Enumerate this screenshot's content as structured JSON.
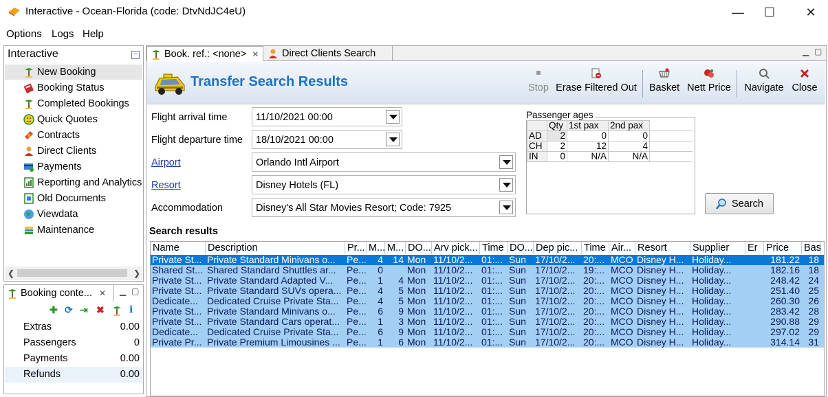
{
  "window": {
    "title": "Interactive - Ocean-Florida (code: DtvNdJC4eU)",
    "minimize": "—",
    "maximize": "☐",
    "close": "✕"
  },
  "menu": [
    "Options",
    "Logs",
    "Help"
  ],
  "sidebar": {
    "title": "Interactive",
    "items": [
      {
        "label": "New Booking",
        "icon": "palm-tree-icon"
      },
      {
        "label": "Booking Status",
        "icon": "book-icon"
      },
      {
        "label": "Completed Bookings",
        "icon": "palm-tree-icon"
      },
      {
        "label": "Quick Quotes",
        "icon": "smiley-icon"
      },
      {
        "label": "Contracts",
        "icon": "satellite-icon"
      },
      {
        "label": "Direct Clients",
        "icon": "person-icon"
      },
      {
        "label": "Payments",
        "icon": "payment-icon"
      },
      {
        "label": "Reporting and Analytics",
        "icon": "report-icon"
      },
      {
        "label": "Old Documents",
        "icon": "document-icon"
      },
      {
        "label": "Viewdata",
        "icon": "globe-icon"
      },
      {
        "label": "Maintenance",
        "icon": "maintenance-icon"
      }
    ]
  },
  "booking_context": {
    "tab_label": "Booking conte...",
    "rows": [
      {
        "label": "Extras",
        "value": "0.00"
      },
      {
        "label": "Passengers",
        "value": "0"
      },
      {
        "label": "Payments",
        "value": "0.00"
      },
      {
        "label": "Refunds",
        "value": "0.00"
      }
    ]
  },
  "tabs": [
    {
      "label": "Book. ref.: <none>"
    },
    {
      "label": "Direct Clients Search"
    }
  ],
  "page": {
    "title": "Transfer Search Results",
    "toolbar": {
      "stop": "Stop",
      "erase": "Erase Filtered Out",
      "basket": "Basket",
      "nett": "Nett Price",
      "navigate": "Navigate",
      "close": "Close"
    }
  },
  "form": {
    "arrival_label": "Flight arrival time",
    "arrival_value": "11/10/2021 00:00",
    "departure_label": "Flight departure time",
    "departure_value": "18/10/2021 00:00",
    "airport_label": "Airport",
    "airport_value": "Orlando Intl Airport",
    "resort_label": "Resort",
    "resort_value": "Disney Hotels (FL)",
    "accommodation_label": "Accommodation",
    "accommodation_value": "Disney's All Star Movies Resort; Code: 7925"
  },
  "passenger_ages": {
    "caption": "Passenger ages",
    "headers": [
      "",
      "Qty",
      "1st pax",
      "2nd pax"
    ],
    "rows": [
      [
        "AD",
        "2",
        "0",
        "0"
      ],
      [
        "CH",
        "2",
        "12",
        "4"
      ],
      [
        "IN",
        "0",
        "N/A",
        "N/A"
      ]
    ]
  },
  "search_button": "Search",
  "results": {
    "label": "Search results",
    "columns": [
      "Name",
      "Description",
      "Pr...",
      "M...",
      "M...",
      "DO...",
      "Arv pick...",
      "Time",
      "DO...",
      "Dep pic...",
      "Time",
      "Air...",
      "Resort",
      "Supplier",
      "Er",
      "Price",
      "Bas"
    ],
    "rows": [
      [
        "Private St...",
        "Private Standard Minivans o...",
        "Pe...",
        "4",
        "14",
        "Mon",
        "11/10/2...",
        "01:...",
        "Sun",
        "17/10/2...",
        "20:...",
        "MCO",
        "Disney H...",
        "Holiday...",
        "",
        "181.22",
        "18"
      ],
      [
        "Shared St...",
        "Shared Standard Shuttles ar...",
        "Pe...",
        "0",
        "",
        "Mon",
        "11/10/2...",
        "01:...",
        "Sun",
        "17/10/2...",
        "19:...",
        "MCO",
        "Disney H...",
        "Holiday...",
        "",
        "182.16",
        "18"
      ],
      [
        "Private St...",
        "Private Standard Adapted V...",
        "Pe...",
        "1",
        "4",
        "Mon",
        "11/10/2...",
        "01:...",
        "Sun",
        "17/10/2...",
        "20:...",
        "MCO",
        "Disney H...",
        "Holiday...",
        "",
        "248.42",
        "24"
      ],
      [
        "Private St...",
        "Private Standard SUVs opera...",
        "Pe...",
        "4",
        "5",
        "Mon",
        "11/10/2...",
        "01:...",
        "Sun",
        "17/10/2...",
        "20:...",
        "MCO",
        "Disney H...",
        "Holiday...",
        "",
        "251.40",
        "25"
      ],
      [
        "Dedicate...",
        "Dedicated Cruise Private Sta...",
        "Pe...",
        "4",
        "5",
        "Mon",
        "11/10/2...",
        "01:...",
        "Sun",
        "17/10/2...",
        "20:...",
        "MCO",
        "Disney H...",
        "Holiday...",
        "",
        "260.30",
        "26"
      ],
      [
        "Private St...",
        "Private Standard Minivans o...",
        "Pe...",
        "6",
        "9",
        "Mon",
        "11/10/2...",
        "01:...",
        "Sun",
        "17/10/2...",
        "20:...",
        "MCO",
        "Disney H...",
        "Holiday...",
        "",
        "283.42",
        "28"
      ],
      [
        "Private St...",
        "Private Standard Cars operat...",
        "Pe...",
        "1",
        "3",
        "Mon",
        "11/10/2...",
        "01:...",
        "Sun",
        "17/10/2...",
        "20:...",
        "MCO",
        "Disney H...",
        "Holiday...",
        "",
        "290.88",
        "29"
      ],
      [
        "Dedicate...",
        "Dedicated Cruise Private Sta...",
        "Pe...",
        "6",
        "9",
        "Mon",
        "11/10/2...",
        "01:...",
        "Sun",
        "17/10/2...",
        "20:...",
        "MCO",
        "Disney H...",
        "Holiday...",
        "",
        "297.02",
        "29"
      ],
      [
        "Private Pr...",
        "Private Premium Limousines ...",
        "Pe...",
        "1",
        "6",
        "Mon",
        "11/10/2...",
        "01:...",
        "Sun",
        "17/10/2...",
        "20:...",
        "MCO",
        "Disney H...",
        "Holiday...",
        "",
        "314.14",
        "31"
      ]
    ]
  },
  "colors": {
    "accent": "#1a73c4",
    "selected_row": "#0a78d7",
    "row_bg": "#a4cff5"
  }
}
